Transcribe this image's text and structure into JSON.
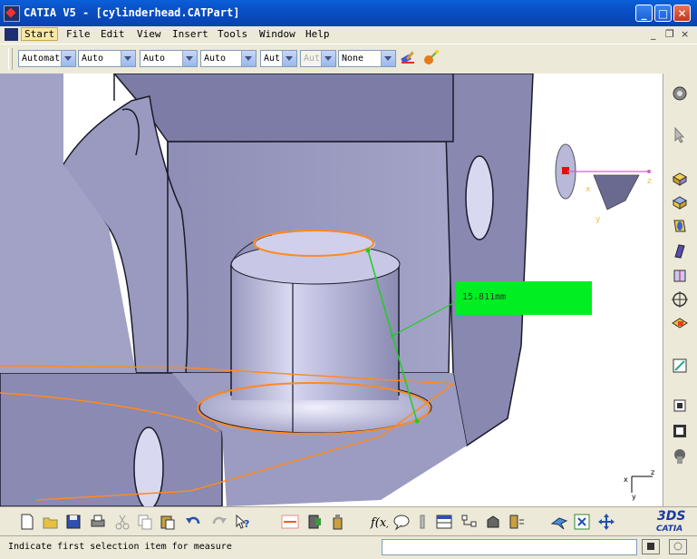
{
  "window": {
    "title": "CATIA V5 - [cylinderhead.CATPart]",
    "controls": {
      "minimize": "_",
      "maximize": "□",
      "close": "✕"
    }
  },
  "menu": {
    "items": [
      {
        "label": "Start"
      },
      {
        "label": "File"
      },
      {
        "label": "Edit"
      },
      {
        "label": "View"
      },
      {
        "label": "Insert"
      },
      {
        "label": "Tools"
      },
      {
        "label": "Window"
      },
      {
        "label": "Help"
      }
    ],
    "mdi": {
      "minimize": "_",
      "restore": "❐",
      "close": "×"
    }
  },
  "toolbar": {
    "combos": [
      {
        "value": "Automat"
      },
      {
        "value": "Auto"
      },
      {
        "value": "Auto"
      },
      {
        "value": "Auto"
      },
      {
        "value": "Aut"
      },
      {
        "value": "Aut",
        "disabled": true
      },
      {
        "value": "None"
      }
    ]
  },
  "viewport": {
    "measure_value": "15.811mm",
    "compass_axes": {
      "x": "x",
      "y": "y",
      "z": "z"
    },
    "triad_axes": {
      "x": "x",
      "y": "y",
      "z": "z"
    }
  },
  "status": {
    "message": "Indicate first selection item for measure"
  },
  "colors": {
    "accent_blue": "#0a5fd8",
    "measure_green": "#00ee22",
    "edge_orange": "#ff8a1e",
    "part_lavender": "#b8b8d8"
  }
}
